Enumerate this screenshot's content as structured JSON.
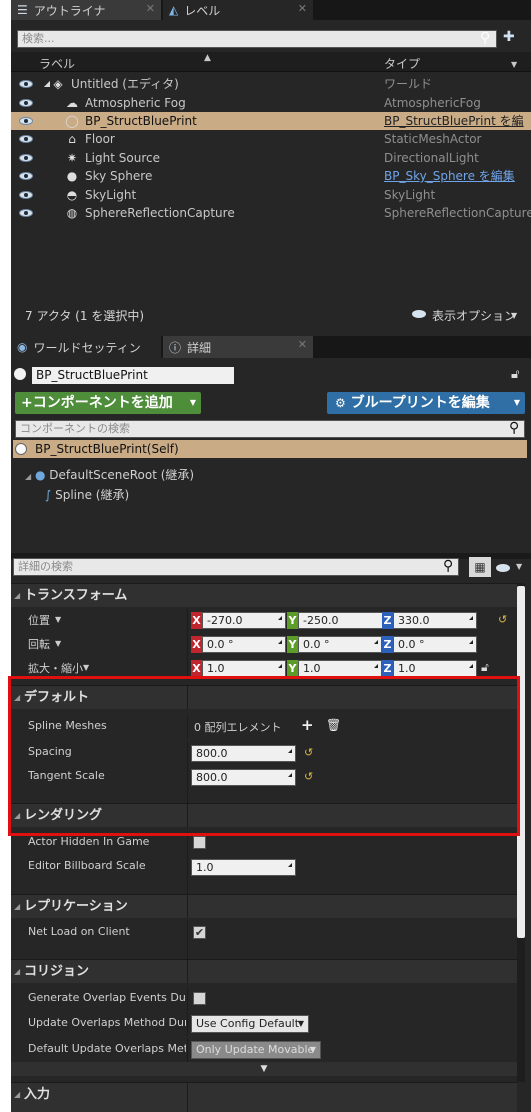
{
  "outliner": {
    "tabs": [
      {
        "label": "アウトライナ",
        "icon": "list-icon"
      },
      {
        "label": "レベル",
        "icon": "level-icon"
      }
    ],
    "search_placeholder": "検索...",
    "columns": {
      "label": "ラベル",
      "type": "タイプ"
    },
    "rows": [
      {
        "label": "Untitled (エディタ)",
        "type": "ワールド",
        "icon": "world-icon",
        "selected": false,
        "type_link": false
      },
      {
        "label": "Atmospheric Fog",
        "type": "AtmosphericFog",
        "icon": "fog-icon",
        "selected": false,
        "type_link": false
      },
      {
        "label": "BP_StructBluePrint",
        "type": "BP_StructBluePrint を編",
        "icon": "blueprint-actor-icon",
        "selected": true,
        "type_link": true
      },
      {
        "label": "Floor",
        "type": "StaticMeshActor",
        "icon": "static-mesh-icon",
        "selected": false,
        "type_link": false
      },
      {
        "label": "Light Source",
        "type": "DirectionalLight",
        "icon": "light-icon",
        "selected": false,
        "type_link": false
      },
      {
        "label": "Sky Sphere",
        "type": "BP_Sky_Sphere を編集",
        "icon": "sphere-icon",
        "selected": false,
        "type_link": true
      },
      {
        "label": "SkyLight",
        "type": "SkyLight",
        "icon": "skylight-icon",
        "selected": false,
        "type_link": false
      },
      {
        "label": "SphereReflectionCapture",
        "type": "SphereReflectionCapture",
        "icon": "reflection-capture-icon",
        "selected": false,
        "type_link": false
      }
    ],
    "actor_count": "7 アクタ (1 を選択中)",
    "view_options": "表示オプション"
  },
  "details": {
    "tabs": [
      {
        "label": "ワールドセッティン",
        "icon": "world-settings-icon"
      },
      {
        "label": "詳細",
        "icon": "details-icon"
      }
    ],
    "actor_name": "BP_StructBluePrint",
    "add_component": "+コンポーネントを追加",
    "edit_blueprint": "ブループリントを編集",
    "component_search_placeholder": "コンポーネントの検索",
    "components": [
      {
        "label": "BP_StructBluePrint(Self)",
        "selected": true
      },
      {
        "label": "DefaultSceneRoot (継承)",
        "selected": false
      },
      {
        "label": "Spline (継承)",
        "selected": false
      }
    ],
    "detail_search_placeholder": "詳細の検索",
    "transform": {
      "title": "トランスフォーム",
      "location": {
        "label": "位置",
        "x": "-270.0",
        "y": "-250.0",
        "z": "330.0"
      },
      "rotation": {
        "label": "回転",
        "x": "0.0 °",
        "y": "0.0 °",
        "z": "0.0 °"
      },
      "scale": {
        "label": "拡大・縮小",
        "x": "1.0",
        "y": "1.0",
        "z": "1.0"
      }
    },
    "default": {
      "title": "デフォルト",
      "spline_meshes": {
        "label": "Spline Meshes",
        "value": "0 配列エレメント"
      },
      "spacing": {
        "label": "Spacing",
        "value": "800.0"
      },
      "tangent_scale": {
        "label": "Tangent Scale",
        "value": "800.0"
      }
    },
    "rendering": {
      "title": "レンダリング",
      "actor_hidden": {
        "label": "Actor Hidden In Game",
        "checked": false
      },
      "billboard_scale": {
        "label": "Editor Billboard Scale",
        "value": "1.0"
      }
    },
    "replication": {
      "title": "レプリケーション",
      "net_load": {
        "label": "Net Load on Client",
        "checked": true
      }
    },
    "collision": {
      "title": "コリジョン",
      "generate_overlap": {
        "label": "Generate Overlap Events During",
        "checked": false
      },
      "update_overlaps": {
        "label": "Update Overlaps Method During",
        "value": "Use Config Default"
      },
      "default_update": {
        "label": "Default Update Overlaps Metho",
        "value": "Only Update Movable"
      }
    },
    "input": {
      "title": "入力"
    }
  },
  "colors": {
    "panel_bg": "#262626",
    "selection": "#c9ab86",
    "add_button": "#4e8d3a",
    "edit_button": "#2f6fa6",
    "highlight_box": "#e01010",
    "axis_x": "#c0262d",
    "axis_y": "#5c9d2a",
    "axis_z": "#2c62bc"
  }
}
